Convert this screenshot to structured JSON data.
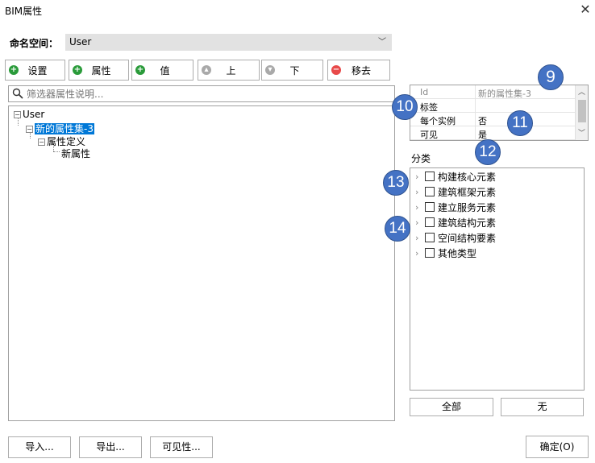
{
  "window": {
    "title": "BIM属性",
    "close_glyph": "✕"
  },
  "namespace": {
    "label": "命名空间：",
    "value": "User"
  },
  "toolbar": {
    "buttons": [
      {
        "label": "设置",
        "icon": "add-icon",
        "color": "#2a9b3a"
      },
      {
        "label": "属性",
        "icon": "add-icon",
        "color": "#2a9b3a"
      },
      {
        "label": "值",
        "icon": "add-icon",
        "color": "#2a9b3a"
      },
      {
        "label": "上",
        "icon": "up-icon",
        "color": "#a9a9a9"
      },
      {
        "label": "下",
        "icon": "down-icon",
        "color": "#a9a9a9"
      },
      {
        "label": "移去",
        "icon": "remove-icon",
        "color": "#e84a4a"
      }
    ]
  },
  "search": {
    "placeholder": "筛选器属性说明..."
  },
  "tree": {
    "root": "User",
    "set": "新的属性集-3",
    "definition": "属性定义",
    "property": "新属性"
  },
  "grid": {
    "rows": [
      {
        "key": "Id",
        "value": "新的属性集-3"
      },
      {
        "key": "标签",
        "value": ""
      },
      {
        "key": "每个实例",
        "value": "否"
      },
      {
        "key": "可见",
        "value": "是"
      }
    ]
  },
  "category": {
    "label": "分类",
    "items": [
      "构建核心元素",
      "建筑框架元素",
      "建立服务元素",
      "建筑结构元素",
      "空间结构要素",
      "其他类型"
    ],
    "all_label": "全部",
    "none_label": "无"
  },
  "footer": {
    "import_label": "导入...",
    "export_label": "导出...",
    "visibility_label": "可见性...",
    "ok_label": "确定(O)"
  },
  "callouts": [
    "9",
    "10",
    "11",
    "12",
    "13",
    "14"
  ],
  "colors": {
    "selection": "#0078d7",
    "badge": "#4472c4"
  }
}
